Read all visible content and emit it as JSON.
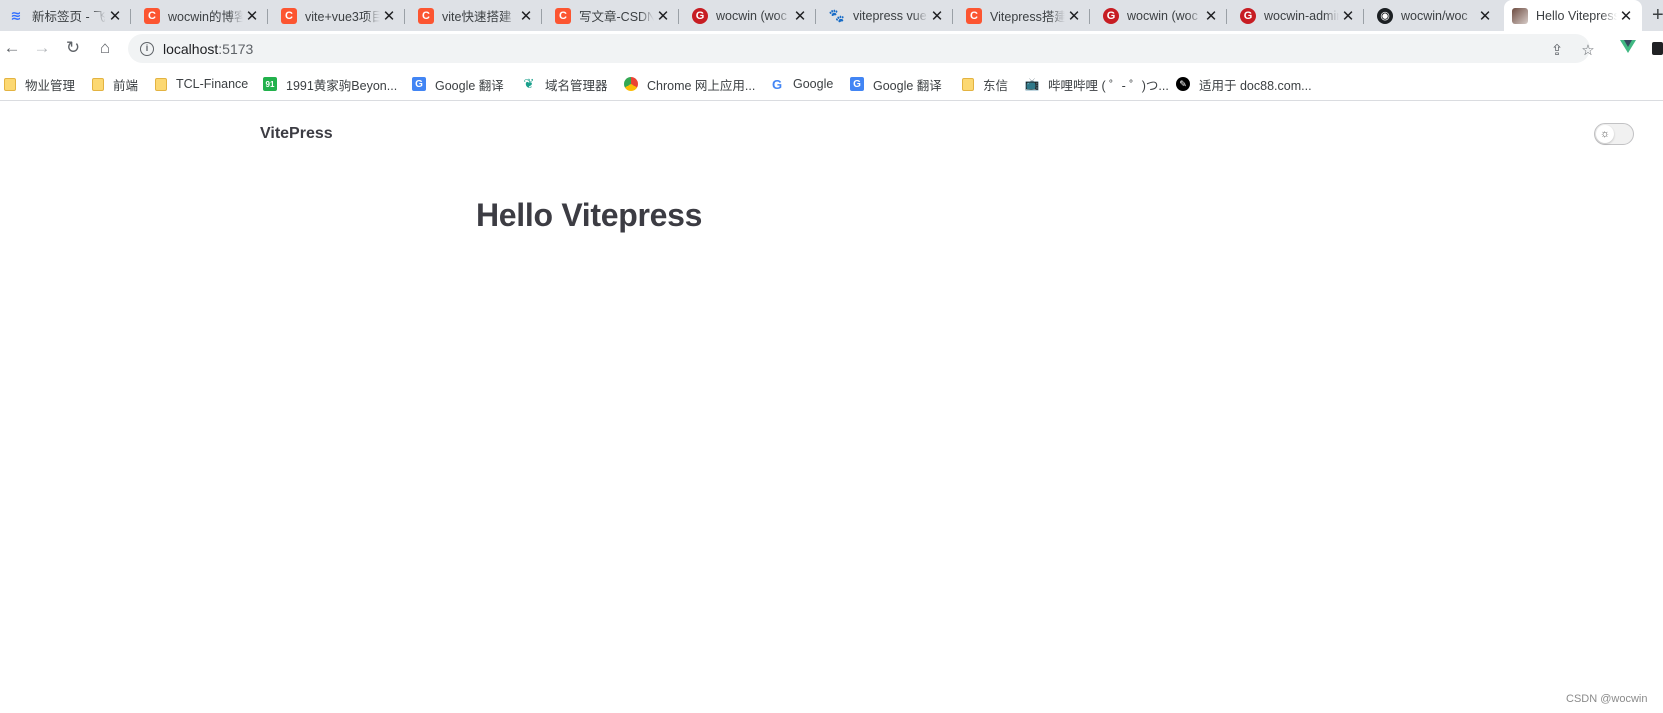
{
  "browser": {
    "tabs": [
      {
        "favicon": "feishu-icon",
        "title": "新标签页 - 飞书",
        "active": false
      },
      {
        "favicon": "csdn-icon",
        "title": "wocwin的博客",
        "active": false
      },
      {
        "favicon": "csdn-icon",
        "title": "vite+vue3项目",
        "active": false
      },
      {
        "favicon": "csdn-icon",
        "title": "vite快速搭建",
        "active": false
      },
      {
        "favicon": "csdn-icon",
        "title": "写文章-CSDN",
        "active": false
      },
      {
        "favicon": "gitee-icon",
        "title": "wocwin (woc",
        "active": false
      },
      {
        "favicon": "baidu-icon",
        "title": "vitepress vue",
        "active": false
      },
      {
        "favicon": "csdn-icon",
        "title": "Vitepress搭建",
        "active": false
      },
      {
        "favicon": "gitee-icon",
        "title": "wocwin (woc",
        "active": false
      },
      {
        "favicon": "gitee-icon",
        "title": "wocwin-admin",
        "active": false
      },
      {
        "favicon": "github-icon",
        "title": "wocwin/woc",
        "active": false
      },
      {
        "favicon": "page-avatar-icon",
        "title": "Hello Vitepress",
        "active": true
      }
    ],
    "new_tab_label": "+",
    "close_glyph": "✕",
    "address": {
      "host": "localhost",
      "port": ":5173"
    },
    "bookmarks": [
      {
        "icon": "folder-icon",
        "label": "物业管理"
      },
      {
        "icon": "folder-icon",
        "label": "前端"
      },
      {
        "icon": "folder-icon",
        "label": "TCL-Finance"
      },
      {
        "icon": "site-1991-icon",
        "label": "1991黄家驹Beyon..."
      },
      {
        "icon": "google-translate-icon",
        "label": "Google 翻译"
      },
      {
        "icon": "domain-manager-icon",
        "label": "域名管理器"
      },
      {
        "icon": "chrome-webstore-icon",
        "label": "Chrome 网上应用..."
      },
      {
        "icon": "google-icon",
        "label": "Google"
      },
      {
        "icon": "google-translate-icon",
        "label": "Google 翻译"
      },
      {
        "icon": "folder-icon",
        "label": "东信"
      },
      {
        "icon": "bilibili-icon",
        "label": "哔哩哔哩 ( ゜- ゜)つ..."
      },
      {
        "icon": "doc88-icon",
        "label": "适用于 doc88.com..."
      }
    ]
  },
  "page": {
    "site_title": "VitePress",
    "heading": "Hello Vitepress",
    "theme_toggle_icon": "sun-icon",
    "watermark": "CSDN @wocwin"
  }
}
